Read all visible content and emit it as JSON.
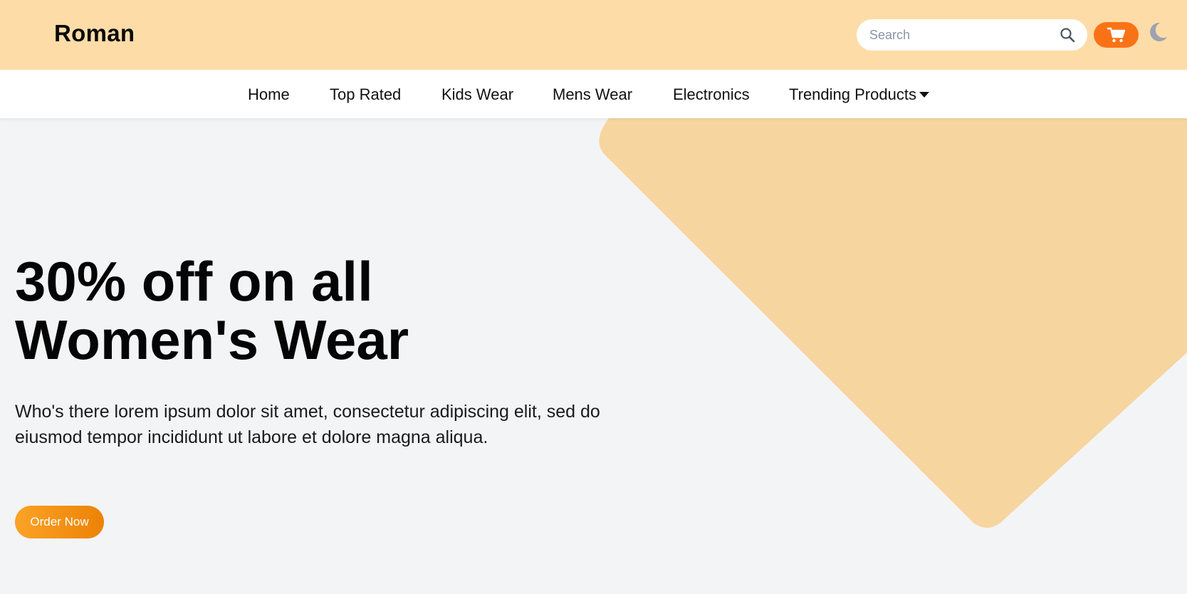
{
  "header": {
    "logo": "Roman",
    "search_placeholder": "Search",
    "search_icon": "search-icon",
    "cart_icon": "cart-icon",
    "theme_icon": "moon-icon"
  },
  "nav": {
    "items": [
      {
        "label": "Home"
      },
      {
        "label": "Top Rated"
      },
      {
        "label": "Kids Wear"
      },
      {
        "label": "Mens Wear"
      },
      {
        "label": "Electronics"
      },
      {
        "label": "Trending Products",
        "icon": "caret-down-icon"
      }
    ]
  },
  "hero": {
    "title_line1": "30% off on all",
    "title_line2": "Women's Wear",
    "description": "Who's there lorem ipsum dolor sit amet, consectetur adipiscing elit, sed do eiusmod tempor incididunt ut labore et dolore magna aliqua.",
    "cta_label": "Order Now"
  },
  "colors": {
    "topbar_bg": "#fedca8",
    "accent": "#f97316",
    "diamond": "#f7d59f",
    "page_bg": "#f3f4f6"
  }
}
